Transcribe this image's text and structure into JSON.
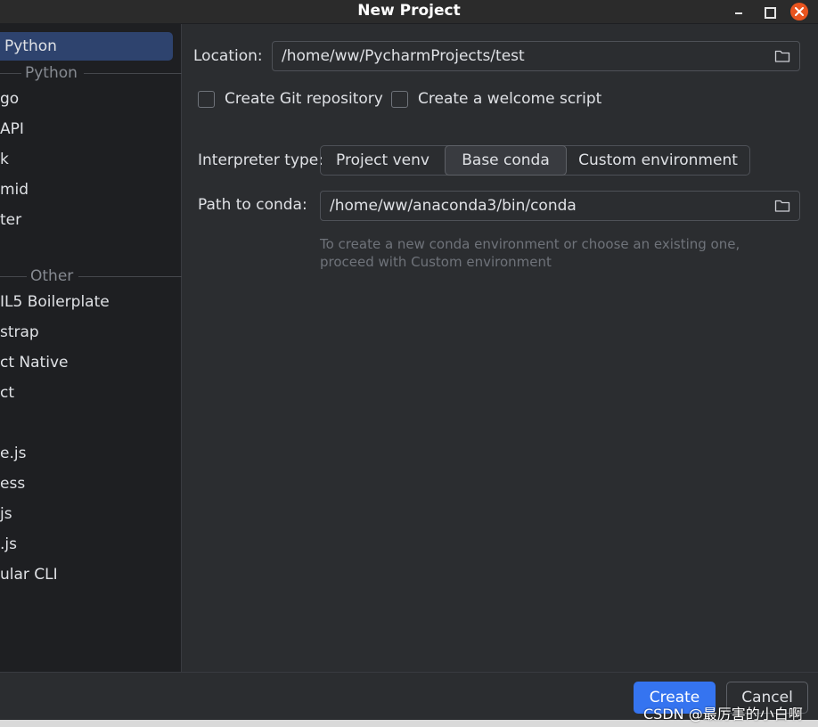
{
  "window": {
    "title": "New Project"
  },
  "sidebar": {
    "selected_item": "Python",
    "sections": [
      {
        "header": "Python",
        "items": [
          "go",
          "API",
          "k",
          "mid",
          "ter"
        ]
      },
      {
        "header": "Other",
        "items": [
          "IL5 Boilerplate",
          "strap",
          "ct Native",
          "ct",
          "e.js",
          "ess",
          "js",
          ".js",
          "ular CLI"
        ]
      }
    ]
  },
  "form": {
    "location_label": "Location:",
    "location_value": "/home/ww/PycharmProjects/test",
    "create_git_label": "Create Git repository",
    "create_welcome_label": "Create a welcome script",
    "interpreter_label": "Interpreter type:",
    "interpreter_options": [
      "Project venv",
      "Base conda",
      "Custom environment"
    ],
    "interpreter_selected": "Base conda",
    "conda_path_label": "Path to conda:",
    "conda_path_value": "/home/ww/anaconda3/bin/conda",
    "hint_line1": "To create a new conda environment or choose an existing one,",
    "hint_line2": "proceed with Custom environment"
  },
  "footer": {
    "create_label": "Create",
    "cancel_label": "Cancel"
  },
  "watermark": "CSDN @最厉害的小白啊",
  "icons": {
    "folder": "folder-icon",
    "close": "close-icon"
  },
  "colors": {
    "accent": "#3574f0",
    "selection": "#2e436e",
    "close_button": "#e9541f"
  }
}
